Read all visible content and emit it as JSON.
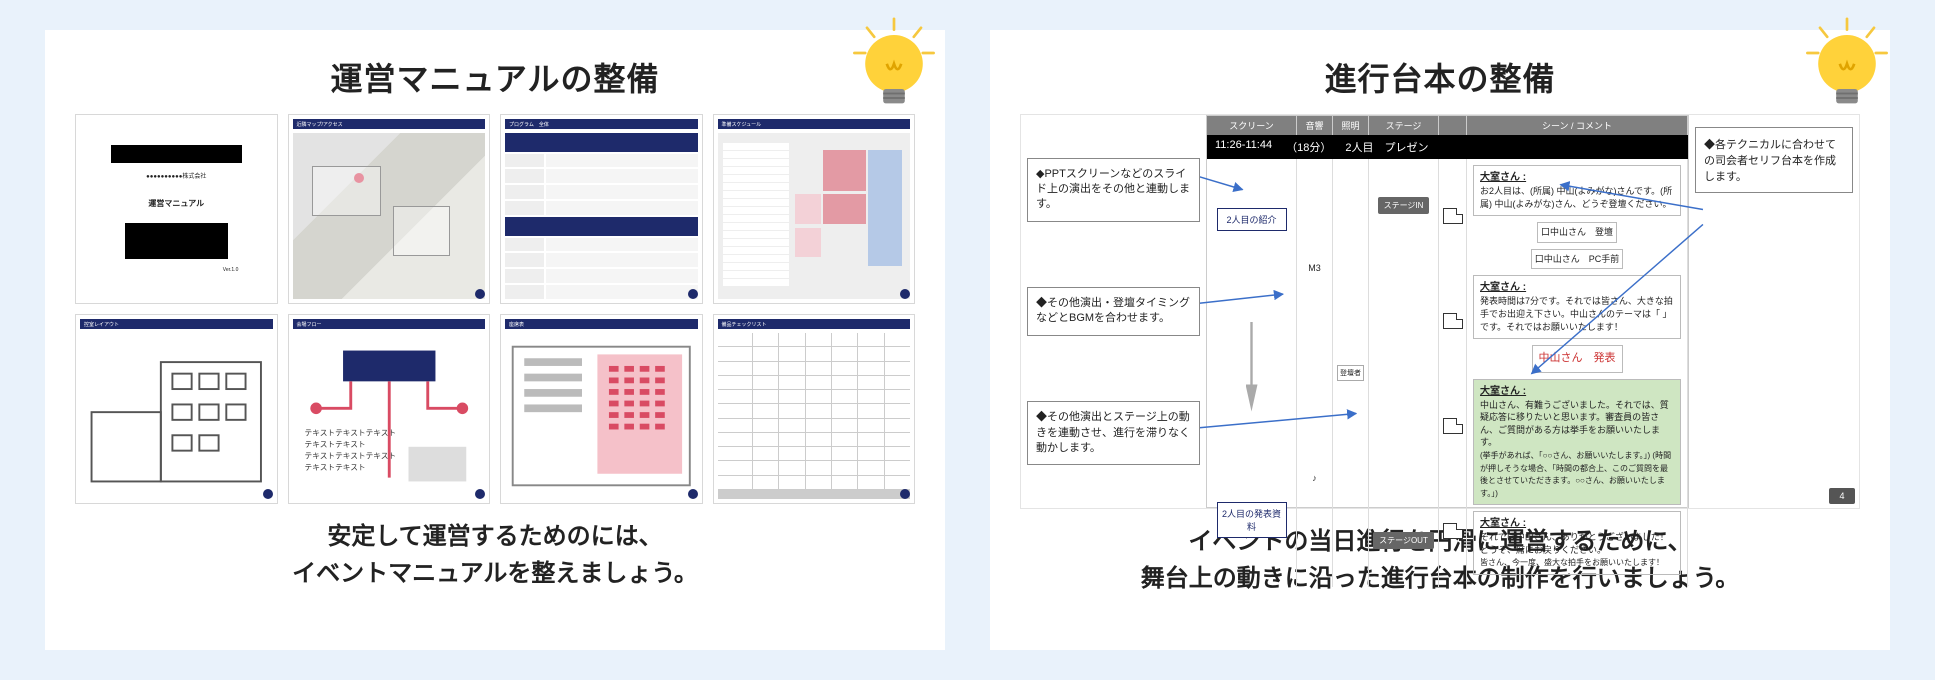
{
  "left": {
    "title": "運営マニュアルの整備",
    "caption_line1": "安定して運営するためのには、",
    "caption_line2": "イベントマニュアルを整えましょう。",
    "thumbs": {
      "cover": {
        "company": "●●●●●●●●●●株式会社",
        "label": "運営マニュアル"
      },
      "access": {
        "header": "近隣マップ/アクセス"
      },
      "program": {
        "header": "プログラム　全体"
      },
      "schedule": {
        "header": "準備スケジュール"
      },
      "layout1": {
        "header": "控室レイアウト"
      },
      "layout2": {
        "header": "会場フロー"
      },
      "layout3": {
        "header": "座席表"
      },
      "checklist": {
        "header": "備品チェックリスト"
      }
    }
  },
  "right": {
    "title": "進行台本の整備",
    "caption_line1": "イベントの当日進行を円滑に運営するために、",
    "caption_line2": "舞台上の動きに沿った進行台本の制作を行いましょう。",
    "callouts": {
      "c1": "◆PPTスクリーンなどのスライド上の演出をその他と連動します。",
      "c2": "◆その他演出・登壇タイミングなどとBGMを合わせます。",
      "c3": "◆その他演出とステージ上の動きを連動させ、進行を滞りなく動かします。",
      "c4": "◆各テクニカルに合わせての司会者セリフ台本を作成します。"
    },
    "timeline": {
      "columns": [
        "スクリーン",
        "音響",
        "照明",
        "ステージ",
        "",
        "シーン / コメント"
      ],
      "time_start": "11:26-11:44",
      "duration": "（18分）",
      "segment": "2人目　プレゼン",
      "chips": {
        "s1": "2人目の紹介",
        "s2": "2人目の発表資料"
      },
      "sound_label": "M3",
      "light_label": "登壇者",
      "stage": {
        "in": "ステージIN",
        "out": "ステージOUT"
      },
      "mc": {
        "speaker": "大室さん :",
        "b1": "お2人目は、(所属) 中山(よみがな)さんです。(所属) 中山(よみがな)さん、どうぞ登壇ください。",
        "n1": "口中山さん　登壇",
        "n2": "口中山さん　PC手前",
        "b2": "発表時間は7分です。それでは皆さん、大きな拍手でお出迎え下さい。中山さんのテーマは「 」です。それではお願いいたします！",
        "b3": "中山さん　発表",
        "b4": "中山さん、有難うございました。それでは、質疑応答に移りたいと思います。審査員の皆さん、ご質問がある方は挙手をお願いいたします。",
        "b4_sub": "(挙手があれば、「○○さん、お願いいたします。」) (時間が押しそうな場合、「時間の都合上、このご質問を最後とさせていただきます。○○さん、お願いいたします。」)",
        "b5": "それでは中山さん、ありがとうございました！どうぞ、席にお戻りください。",
        "b5_sub": "皆さん、今一度、盛大な拍手をお願いいたします！"
      },
      "page": "4"
    }
  }
}
